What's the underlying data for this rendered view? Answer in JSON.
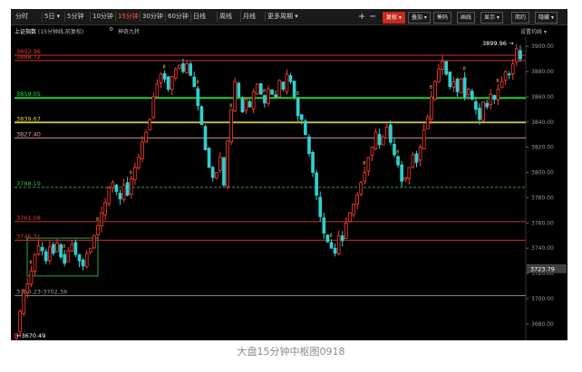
{
  "toolbar": {
    "tabs": [
      {
        "label": "分时",
        "active": false
      },
      {
        "label": "5日 ▾",
        "active": false
      },
      {
        "label": "5分钟",
        "active": false
      },
      {
        "label": "10分钟",
        "active": false
      },
      {
        "label": "15分钟",
        "active": true
      },
      {
        "label": "30分钟",
        "active": false
      },
      {
        "label": "60分钟",
        "active": false
      },
      {
        "label": "日线",
        "active": false
      },
      {
        "label": "周线",
        "active": false
      },
      {
        "label": "月线",
        "active": false
      },
      {
        "label": "更多周期 ▾",
        "active": false
      }
    ],
    "zoom_in": "+",
    "zoom_out": "−",
    "buttons": [
      {
        "label": "复权 ▾",
        "style": "red"
      },
      {
        "label": "叠加 ▾",
        "style": "dark"
      },
      {
        "label": "筹码",
        "style": "dark"
      },
      {
        "label": "画线",
        "style": "dark"
      },
      {
        "label": "显示 ▾",
        "style": "dark"
      },
      {
        "label": "简约",
        "style": "dark"
      },
      {
        "label": "隐藏 ▾",
        "style": "dark"
      }
    ]
  },
  "info_bar": {
    "title": "上证指数",
    "subtitle": "(15分钟线,前复权)",
    "gear_label": "神奇九转",
    "settings": "设置均线 ▾"
  },
  "level_lines": [
    {
      "label": "3892.96",
      "price": 3892.96,
      "color": "#e03a2f"
    },
    {
      "label": "3888.72",
      "price": 3888.72,
      "color": "#e03a2f"
    },
    {
      "label": "3859.05",
      "price": 3859.05,
      "color": "#21e83b"
    },
    {
      "label": "3839.67",
      "price": 3839.67,
      "color": "#d8cf4a"
    },
    {
      "label": "3827.40",
      "price": 3827.4,
      "color": "#e6a3a3"
    },
    {
      "label": "3788.19",
      "price": 3788.19,
      "color": "#3bb84a"
    },
    {
      "label": "3761.08",
      "price": 3761.08,
      "color": "#e03a2f"
    },
    {
      "label": "3746.31",
      "price": 3746.31,
      "color": "#e03a2f"
    },
    {
      "label": "3700.23-3702.38",
      "price": 3702.38,
      "color": "#9a9a9a"
    }
  ],
  "current_price_label": "3723.79",
  "high_annotation": "3899.96 →",
  "low_annotation": "←3670.49",
  "chart_data": {
    "type": "candlestick",
    "y_axis": {
      "ticks": [
        3900,
        3880,
        3860,
        3840,
        3820,
        3800,
        3780,
        3760,
        3740,
        3720,
        3700,
        3680
      ],
      "range": [
        3667,
        3908
      ]
    },
    "close_path": [
      3672,
      3690,
      3705,
      3712,
      3722,
      3735,
      3742,
      3738,
      3730,
      3741,
      3736,
      3744,
      3733,
      3728,
      3738,
      3743,
      3735,
      3730,
      3726,
      3736,
      3740,
      3750,
      3758,
      3768,
      3776,
      3788,
      3792,
      3785,
      3779,
      3790,
      3782,
      3795,
      3804,
      3812,
      3824,
      3832,
      3842,
      3860,
      3870,
      3878,
      3874,
      3866,
      3876,
      3882,
      3885,
      3880,
      3886,
      3877,
      3868,
      3853,
      3838,
      3818,
      3804,
      3796,
      3800,
      3812,
      3790,
      3825,
      3850,
      3872,
      3860,
      3848,
      3858,
      3852,
      3864,
      3870,
      3862,
      3855,
      3866,
      3862,
      3860,
      3873,
      3866,
      3878,
      3872,
      3860,
      3845,
      3842,
      3830,
      3815,
      3800,
      3782,
      3765,
      3752,
      3745,
      3740,
      3736,
      3750,
      3746,
      3760,
      3768,
      3775,
      3782,
      3792,
      3800,
      3812,
      3820,
      3832,
      3822,
      3828,
      3836,
      3824,
      3814,
      3806,
      3793,
      3796,
      3804,
      3814,
      3808,
      3820,
      3834,
      3844,
      3860,
      3872,
      3882,
      3888,
      3878,
      3868,
      3872,
      3864,
      3874,
      3860,
      3866,
      3858,
      3850,
      3842,
      3856,
      3852,
      3862,
      3858,
      3866,
      3872,
      3880,
      3878,
      3886,
      3898,
      3890
    ],
    "annotations": [
      "3899.96",
      "3670.49"
    ]
  },
  "caption": "大盘15分钟中枢图0918"
}
